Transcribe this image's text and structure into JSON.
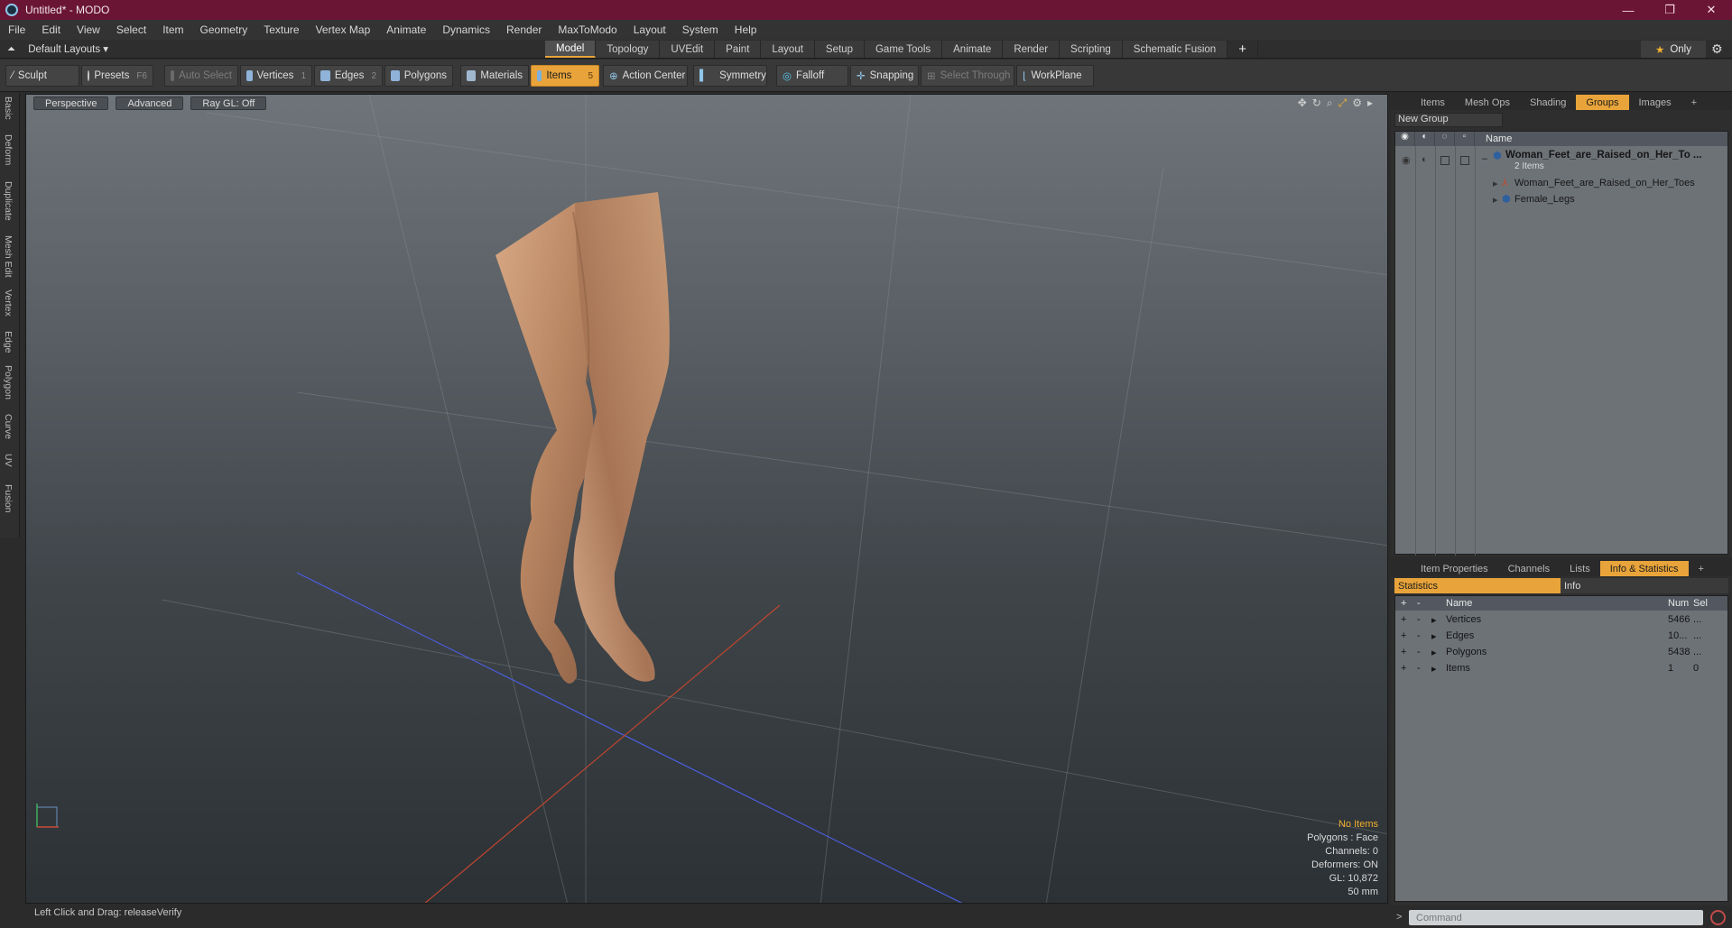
{
  "window": {
    "title": "Untitled* - MODO",
    "minimize": "—",
    "maximize": "❐",
    "close": "✕"
  },
  "menu": [
    "File",
    "Edit",
    "View",
    "Select",
    "Item",
    "Geometry",
    "Texture",
    "Vertex Map",
    "Animate",
    "Dynamics",
    "Render",
    "MaxToModo",
    "Layout",
    "System",
    "Help"
  ],
  "layout_bar": {
    "dropdown": "Default Layouts ▾",
    "tabs": [
      "Model",
      "Topology",
      "UVEdit",
      "Paint",
      "Layout",
      "Setup",
      "Game Tools",
      "Animate",
      "Render",
      "Scripting",
      "Schematic Fusion"
    ],
    "active_tab": "Model",
    "add": "+",
    "only": "Only",
    "star": "★"
  },
  "toolbar": {
    "sculpt": "Sculpt",
    "presets": "Presets",
    "presets_key": "F6",
    "auto_select": "Auto Select",
    "vertices": "Vertices",
    "vertices_key": "1",
    "edges": "Edges",
    "edges_key": "2",
    "polygons": "Polygons",
    "materials": "Materials",
    "items": "Items",
    "items_key": "5",
    "action_center": "Action Center",
    "symmetry": "Symmetry",
    "falloff": "Falloff",
    "snapping": "Snapping",
    "select_through": "Select Through",
    "workplane": "WorkPlane"
  },
  "left_tabs": [
    "Basic",
    "Deform",
    "Duplicate",
    "Mesh Edit",
    "Vertex",
    "Edge",
    "Polygon",
    "Curve",
    "UV",
    "Fusion"
  ],
  "viewport": {
    "view": "Perspective",
    "shading": "Advanced",
    "raygl": "Ray GL: Off",
    "info": {
      "no_items": "No Items",
      "polygons": "Polygons : Face",
      "channels": "Channels: 0",
      "deformers": "Deformers: ON",
      "gl": "GL: 10,872",
      "scale": "50 mm"
    }
  },
  "status_bar": "Left Click and Drag:   releaseVerify",
  "groups_panel": {
    "tabs": [
      "Items",
      "Mesh Ops",
      "Shading",
      "Groups",
      "Images"
    ],
    "active_tab": "Groups",
    "new_group": "New Group",
    "name_header": "Name",
    "group_name": "Woman_Feet_are_Raised_on_Her_To ...",
    "group_count": "2 Items",
    "children": [
      "Woman_Feet_are_Raised_on_Her_Toes",
      "Female_Legs"
    ]
  },
  "info_panel": {
    "tabs": [
      "Item Properties",
      "Channels",
      "Lists",
      "Info & Statistics"
    ],
    "active_tab": "Info & Statistics",
    "subtab_statistics": "Statistics",
    "subtab_info": "Info",
    "headers": {
      "plus": "+",
      "minus": "-",
      "name": "Name",
      "num": "Num",
      "sel": "Sel"
    },
    "rows": [
      {
        "name": "Vertices",
        "num": "5466",
        "sel": "..."
      },
      {
        "name": "Edges",
        "num": "10...",
        "sel": "..."
      },
      {
        "name": "Polygons",
        "num": "5438",
        "sel": "..."
      },
      {
        "name": "Items",
        "num": "1",
        "sel": "0"
      }
    ]
  },
  "command": {
    "prompt": ">",
    "placeholder": "Command"
  },
  "colors": {
    "title_bar": "#6b1535",
    "accent": "#e8a43a"
  }
}
